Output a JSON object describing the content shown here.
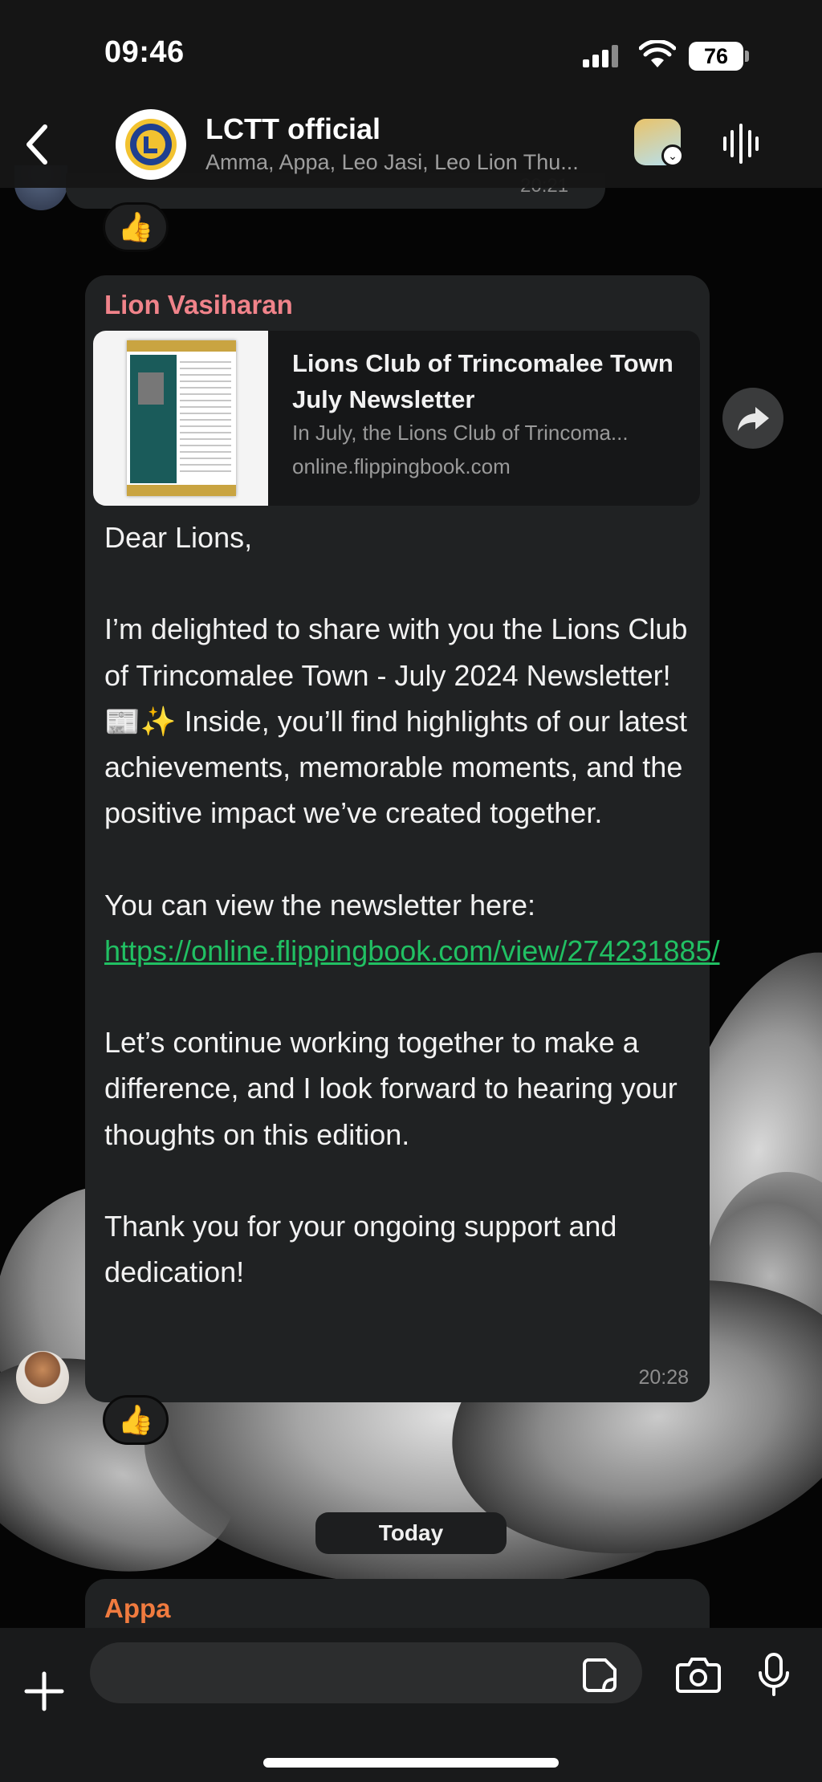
{
  "status_bar": {
    "time": "09:46",
    "battery": "76"
  },
  "header": {
    "group_name": "LCTT official",
    "members": "Amma, Appa, Leo Jasi, Leo Lion Thu..."
  },
  "chat": {
    "previous_message_time": "20:21",
    "reaction_emoji": "👍",
    "message": {
      "sender": "Lion Vasiharan",
      "link_preview": {
        "title": "Lions Club of Trincomalee Town July Newsletter",
        "description": "In July, the Lions Club of Trincoma...",
        "domain": "online.flippingbook.com"
      },
      "greeting": "Dear Lions,",
      "paragraph1": "I’m delighted to share with you the Lions Club of Trincomalee Town - July 2024 Newsletter! 📰✨ Inside, you’ll find highlights of our latest achievements, memorable moments, and the positive impact we’ve created together.",
      "link_intro": "You can view the newsletter here:",
      "link_url": "https://online.flippingbook.com/view/274231885/",
      "paragraph3": "Let’s continue working together to make a difference, and I look forward to hearing your thoughts on this edition.",
      "paragraph4": "Thank you for your ongoing support and dedication!",
      "time": "20:28",
      "reaction_emoji": "👍"
    },
    "date_separator": "Today",
    "next_message_sender": "Appa"
  },
  "input_bar": {
    "placeholder": ""
  },
  "colors": {
    "sender_vasiharan": "#f0838a",
    "sender_appa": "#f07b3f",
    "link": "#21c063",
    "bubble": "#202223"
  },
  "icons": {
    "back": "chevron-left-icon",
    "voice_chat": "waveform-icon",
    "forward": "share-arrow-icon",
    "plus": "plus-icon",
    "sticker": "sticker-icon",
    "camera": "camera-icon",
    "mic": "microphone-icon"
  }
}
